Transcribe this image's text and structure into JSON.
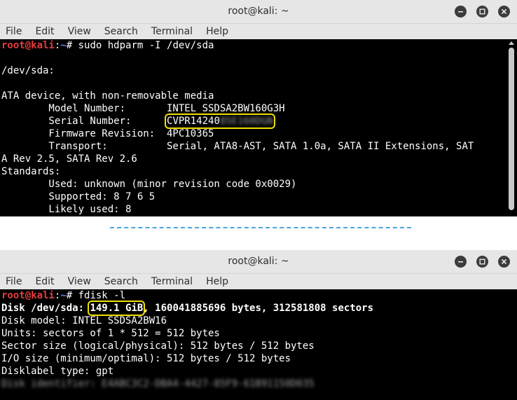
{
  "window1": {
    "title": "root@kali: ~",
    "menu": [
      "File",
      "Edit",
      "View",
      "Search",
      "Terminal",
      "Help"
    ],
    "prompt_user": "root@kali",
    "prompt_sep": ":",
    "prompt_path": "~",
    "prompt_hash": "# ",
    "command": "sudo hdparm -I /dev/sda",
    "lines": [
      "",
      "/dev/sda:",
      "",
      "ATA device, with non-removable media",
      "        Model Number:       INTEL SSDSA2BW160G3H"
    ],
    "serial_prefix": "        Serial Number:      ",
    "serial_visible": "CVPR14240",
    "serial_blurred": "85E160DGN",
    "lines_after": [
      "        Firmware Revision:  4PC10365",
      "        Transport:          Serial, ATA8-AST, SATA 1.0a, SATA II Extensions, SAT",
      "A Rev 2.5, SATA Rev 2.6",
      "Standards:",
      "        Used: unknown (minor revision code 0x0029)",
      "        Supported: 8 7 6 5",
      "        Likely used: 8"
    ]
  },
  "window2": {
    "title": "root@kali: ~",
    "menu": [
      "File",
      "Edit",
      "View",
      "Search",
      "Terminal",
      "Help"
    ],
    "prompt_user": "root@kali",
    "prompt_sep": ":",
    "prompt_path": "~",
    "prompt_hash": "# ",
    "command": "fdisk -l",
    "disk_prefix": "Disk /dev/sda: ",
    "disk_size": "149.1 GiB",
    "disk_suffix": ", 160041885696 bytes, 312581808 sectors",
    "lines": [
      "Disk model: INTEL SSDSA2BW16",
      "Units: sectors of 1 * 512 = 512 bytes",
      "Sector size (logical/physical): 512 bytes / 512 bytes",
      "I/O size (minimum/optimal): 512 bytes / 512 bytes",
      "Disklabel type: gpt"
    ],
    "blurred_line": "Disk identifier: E4ABC3C2-DBA4-4427-85F9-61B91150D035"
  }
}
